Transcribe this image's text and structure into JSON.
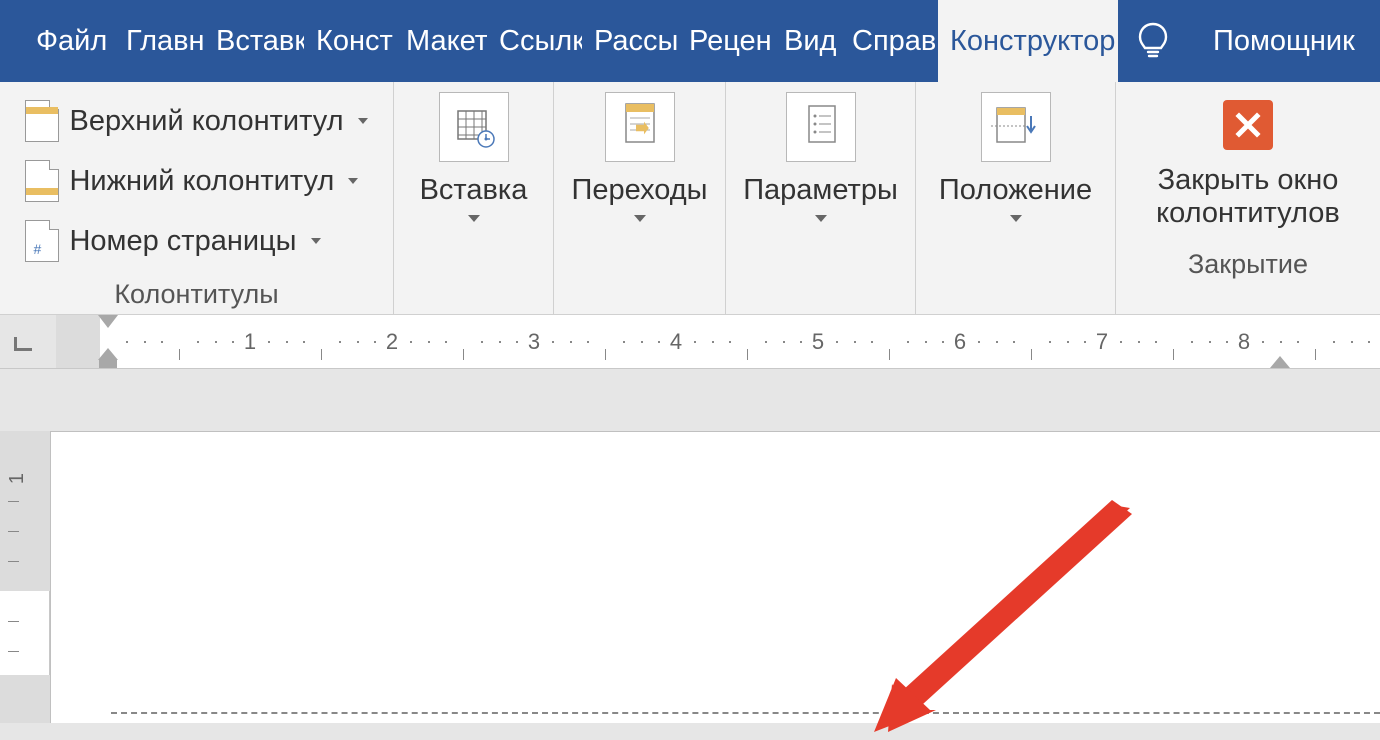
{
  "tabs": {
    "file": "Файл",
    "home": "Главная",
    "insert": "Вставка",
    "design": "Конструктор",
    "layout": "Макет",
    "references": "Ссылки",
    "mailings": "Рассылки",
    "review": "Рецензирование",
    "view": "Вид",
    "help": "Справка",
    "designer_active": "Конструктор",
    "help_right": "Помощник"
  },
  "ribbon": {
    "group1": {
      "header": "Верхний колонтитул",
      "footer": "Нижний колонтитул",
      "pagenum": "Номер страницы",
      "label": "Колонтитулы"
    },
    "groups_big": {
      "insert": "Вставка",
      "transitions": "Переходы",
      "params": "Параметры",
      "position": "Положение"
    },
    "close": {
      "close_btn": "Закрыть окно колонтитулов",
      "label": "Закрытие"
    }
  },
  "ruler": {
    "numbers": [
      "1",
      "2",
      "3",
      "4",
      "5",
      "6",
      "7",
      "8"
    ]
  },
  "v_ruler": {
    "numbers": [
      "1"
    ]
  },
  "colors": {
    "ribbon_blue": "#2b579a",
    "active_tab_text": "#2b579a",
    "close_orange": "#e05a33",
    "arrow_red": "#e53a2a"
  }
}
